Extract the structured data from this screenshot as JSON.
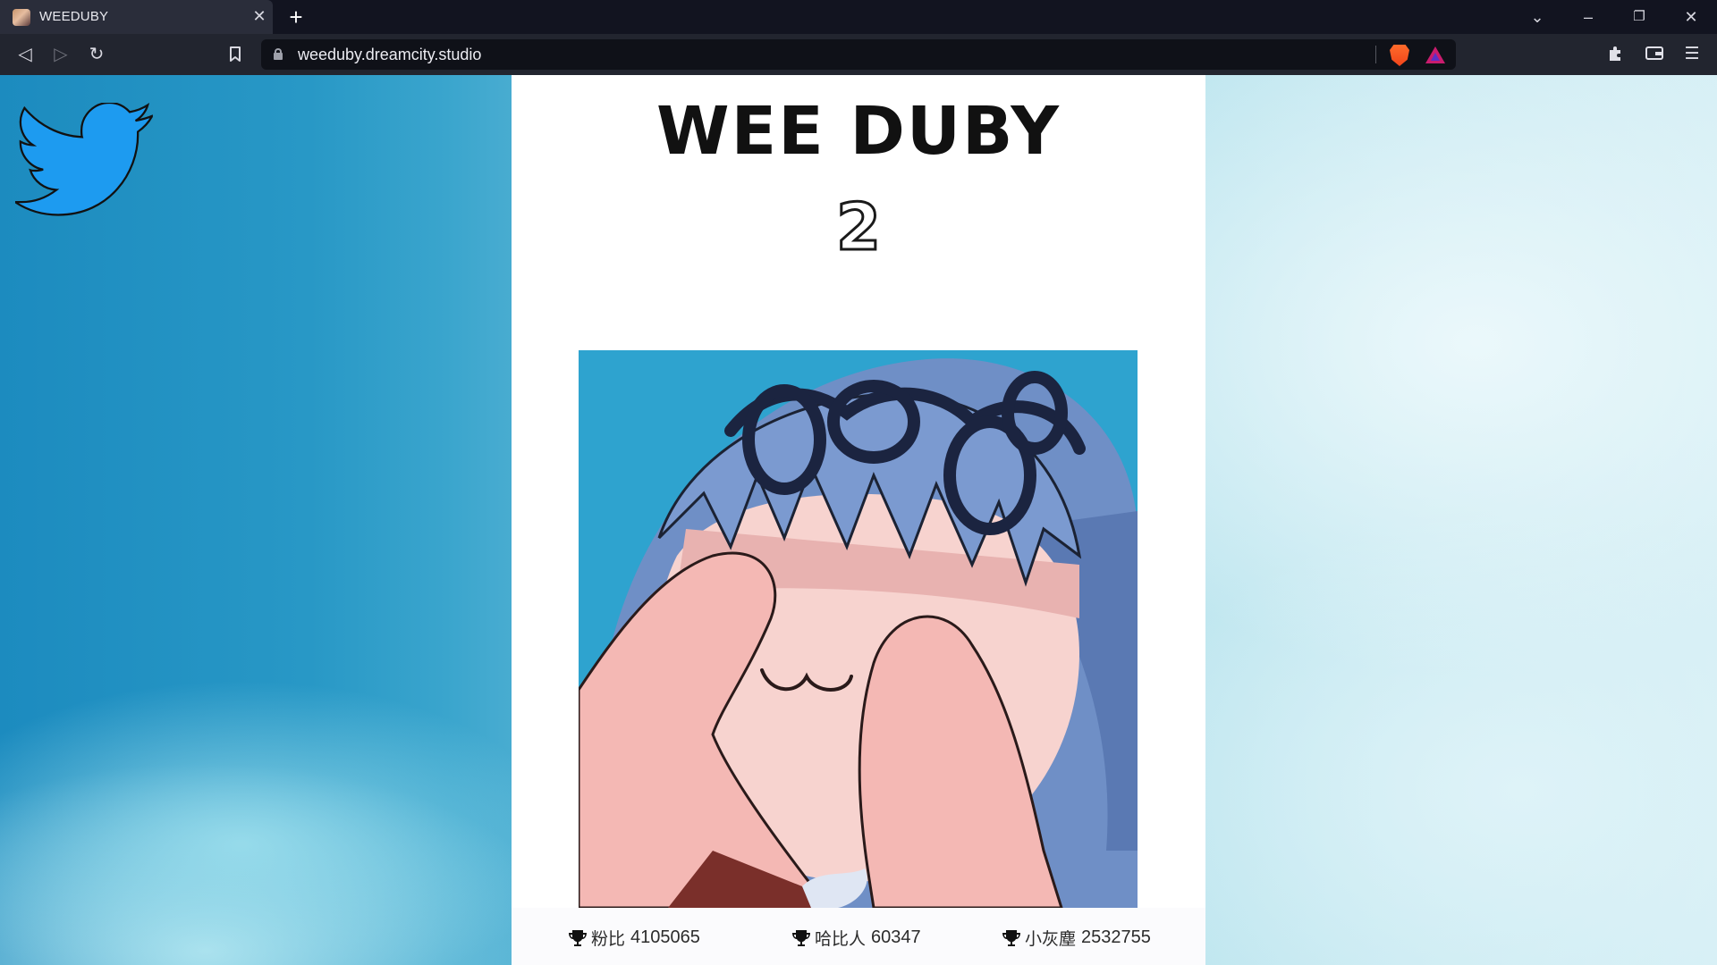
{
  "browser": {
    "tab": {
      "title": "WEEDUBY"
    },
    "address_bar": {
      "url": "weeduby.dreamcity.studio"
    }
  },
  "page": {
    "social_link": {
      "icon": "twitter-bird-icon"
    },
    "title": "WEE DUBY",
    "subtitle": "2",
    "artwork": {
      "icon": "anime-girl-covering-face-image"
    },
    "leaderboard": [
      {
        "label": "粉比",
        "value": "4105065"
      },
      {
        "label": "哈比人",
        "value": "60347"
      },
      {
        "label": "小灰塵",
        "value": "2532755"
      }
    ]
  }
}
